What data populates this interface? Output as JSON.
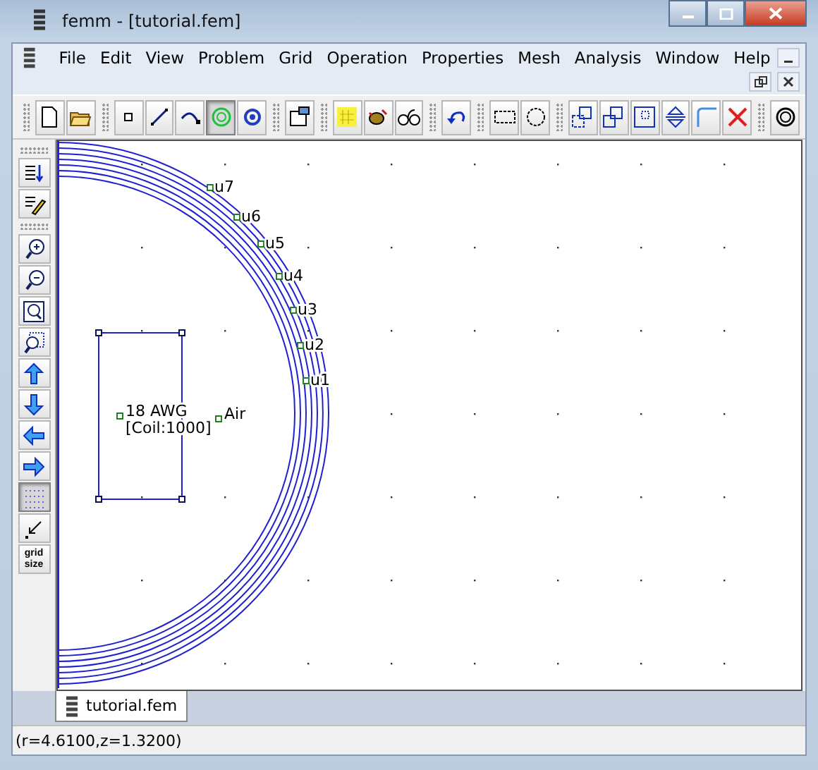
{
  "window": {
    "title": "femm - [tutorial.fem]"
  },
  "menu": [
    "File",
    "Edit",
    "View",
    "Problem",
    "Grid",
    "Operation",
    "Properties",
    "Mesh",
    "Analysis",
    "Window",
    "Help"
  ],
  "toolbar": [
    [
      {
        "kind": "new",
        "selected": false
      },
      {
        "kind": "open",
        "selected": false
      }
    ],
    [
      {
        "kind": "node",
        "selected": false
      },
      {
        "kind": "segment",
        "selected": false
      },
      {
        "kind": "arc",
        "selected": false
      },
      {
        "kind": "group",
        "selected": true
      },
      {
        "kind": "block",
        "selected": false
      }
    ],
    [
      {
        "kind": "props",
        "selected": false
      }
    ],
    [
      {
        "kind": "mesh",
        "selected": false
      },
      {
        "kind": "run",
        "selected": false
      },
      {
        "kind": "view",
        "selected": false
      }
    ],
    [
      {
        "kind": "undo",
        "selected": false
      }
    ],
    [
      {
        "kind": "selbox",
        "selected": false
      },
      {
        "kind": "selcircle",
        "selected": false
      }
    ],
    [
      {
        "kind": "move",
        "selected": false
      },
      {
        "kind": "copy",
        "selected": false
      },
      {
        "kind": "scale",
        "selected": false
      },
      {
        "kind": "mirror",
        "selected": false
      },
      {
        "kind": "fillet",
        "selected": false
      },
      {
        "kind": "delete",
        "selected": false
      }
    ],
    [
      {
        "kind": "boundary",
        "selected": false
      }
    ]
  ],
  "side_toolbar": [
    [
      {
        "kind": "sort",
        "selected": false
      },
      {
        "kind": "edit",
        "selected": false
      }
    ],
    [
      {
        "kind": "zoomin",
        "selected": false
      },
      {
        "kind": "zoomout",
        "selected": false
      },
      {
        "kind": "zoomfit",
        "selected": false
      },
      {
        "kind": "zoomwin",
        "selected": false
      },
      {
        "kind": "up",
        "selected": false
      },
      {
        "kind": "down",
        "selected": false
      },
      {
        "kind": "left",
        "selected": false
      },
      {
        "kind": "right",
        "selected": false
      },
      {
        "kind": "grid",
        "selected": true
      },
      {
        "kind": "snap",
        "selected": false
      },
      {
        "kind": "gridsize",
        "selected": false,
        "label": [
          "grid",
          "size"
        ]
      }
    ]
  ],
  "canvas": {
    "node_labels": [
      "u7",
      "u6",
      "u5",
      "u4",
      "u3",
      "u2",
      "u1"
    ],
    "block_labels": [
      {
        "lines": [
          "18 AWG",
          "[Coil:1000]"
        ]
      },
      {
        "lines": [
          "Air"
        ]
      }
    ]
  },
  "tabs": [
    {
      "label": "tutorial.fem",
      "selected": true
    }
  ],
  "status_bar": "(r=4.6100,z=1.3200)"
}
